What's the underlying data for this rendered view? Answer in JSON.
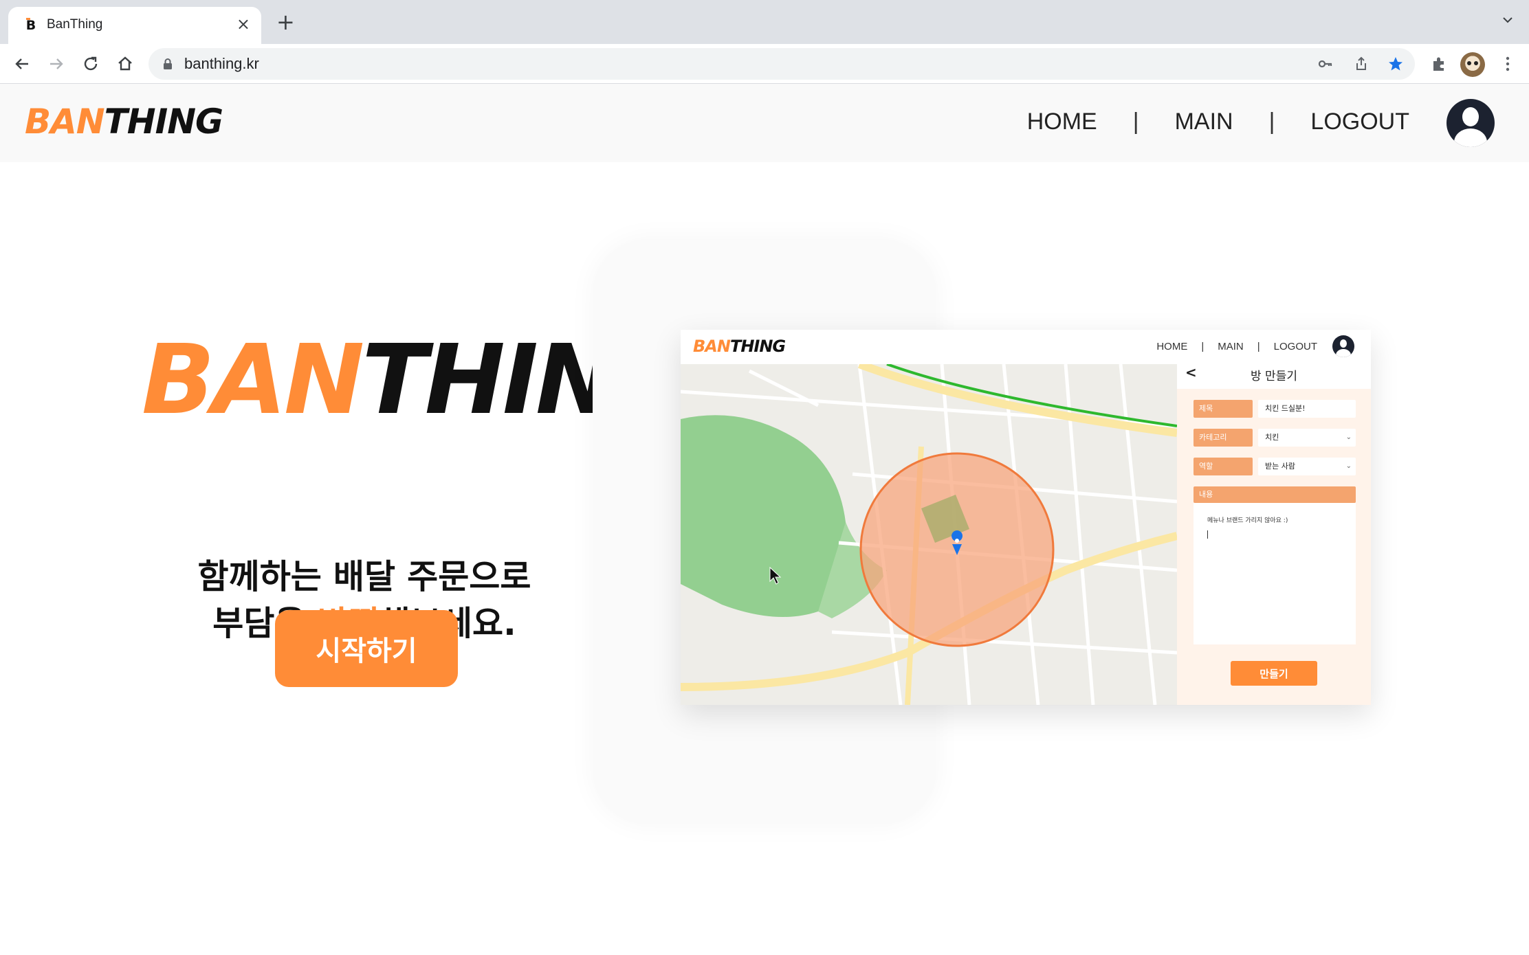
{
  "browser": {
    "tab_title": "BanThing",
    "favicon_letter": "B",
    "close_glyph": "×",
    "new_tab_glyph": "+",
    "url": "banthing.kr",
    "icons": [
      "back-icon",
      "forward-icon",
      "reload-icon",
      "home-icon",
      "lock-icon",
      "key-icon",
      "share-icon",
      "bookmark-star-icon",
      "extensions-icon",
      "profile-avatar",
      "more-menu-icon",
      "tab-list-chevron-icon"
    ]
  },
  "header": {
    "logo_ban": "BAN",
    "logo_thing": "THING",
    "nav": {
      "home": "HOME",
      "main": "MAIN",
      "logout": "LOGOUT",
      "separator": "|"
    }
  },
  "hero": {
    "logo_ban": "BAN",
    "logo_thing": "THING",
    "line1": "함께하는 배달 주문으로",
    "line2_before": "부담을 ",
    "line2_accent": "반띵",
    "line2_after": "해보세요.",
    "start_button": "시작하기"
  },
  "preview": {
    "logo_ban": "BAN",
    "logo_thing": "THING",
    "nav": {
      "home": "HOME",
      "main": "MAIN",
      "logout": "LOGOUT",
      "separator": "|"
    },
    "panel": {
      "back": "<",
      "title": "방 만들기",
      "fields": [
        {
          "label": "제목",
          "value": "치킨 드실분!"
        },
        {
          "label": "카테고리",
          "value": "치킨"
        },
        {
          "label": "역할",
          "value": "받는 사람"
        }
      ],
      "content_label": "내용",
      "content_text": "메뉴나 브랜드 가리지 않아요 :)",
      "make_button": "만들기"
    }
  },
  "colors": {
    "accent": "#ff8c37",
    "panel_label": "#f4a46e",
    "panel_bg": "#fff3ea",
    "dark": "#1c2230",
    "map_green": "#93cf90",
    "map_road_yellow": "#fbe7a3"
  }
}
